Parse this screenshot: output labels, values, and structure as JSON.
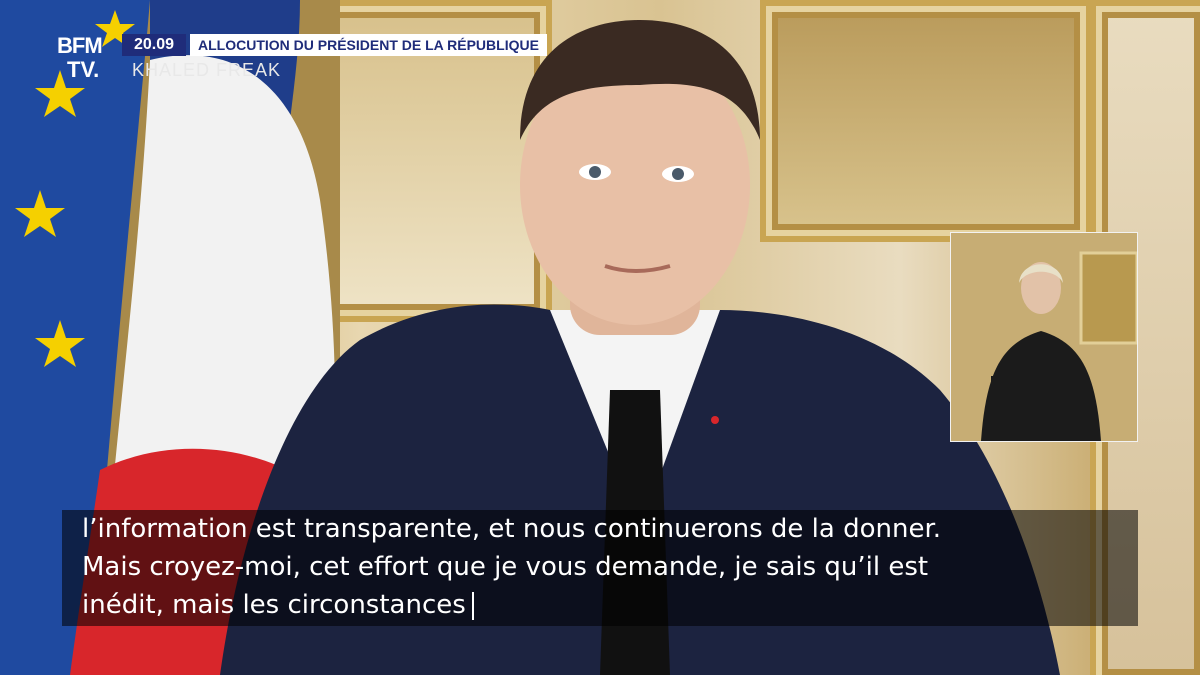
{
  "broadcast": {
    "logo_line1": "BFM",
    "logo_line2": "TV.",
    "time": "20.09",
    "headline": "ALLOCUTION DU PRÉSIDENT DE LA RÉPUBLIQUE",
    "channel_name": "KHALED FREAK"
  },
  "subtitles": {
    "line1": "l’information est transparente, et nous continuerons de la donner.",
    "line2": "Mais croyez-moi, cet effort que je vous demande, je sais qu’il est",
    "line3": "inédit, mais les circonstances"
  },
  "colors": {
    "bfm_blue": "#1f2c7a",
    "eu_blue": "#1f4aa0",
    "eu_star": "#f5d000",
    "fr_red": "#d8262b",
    "suit": "#1c2340"
  }
}
